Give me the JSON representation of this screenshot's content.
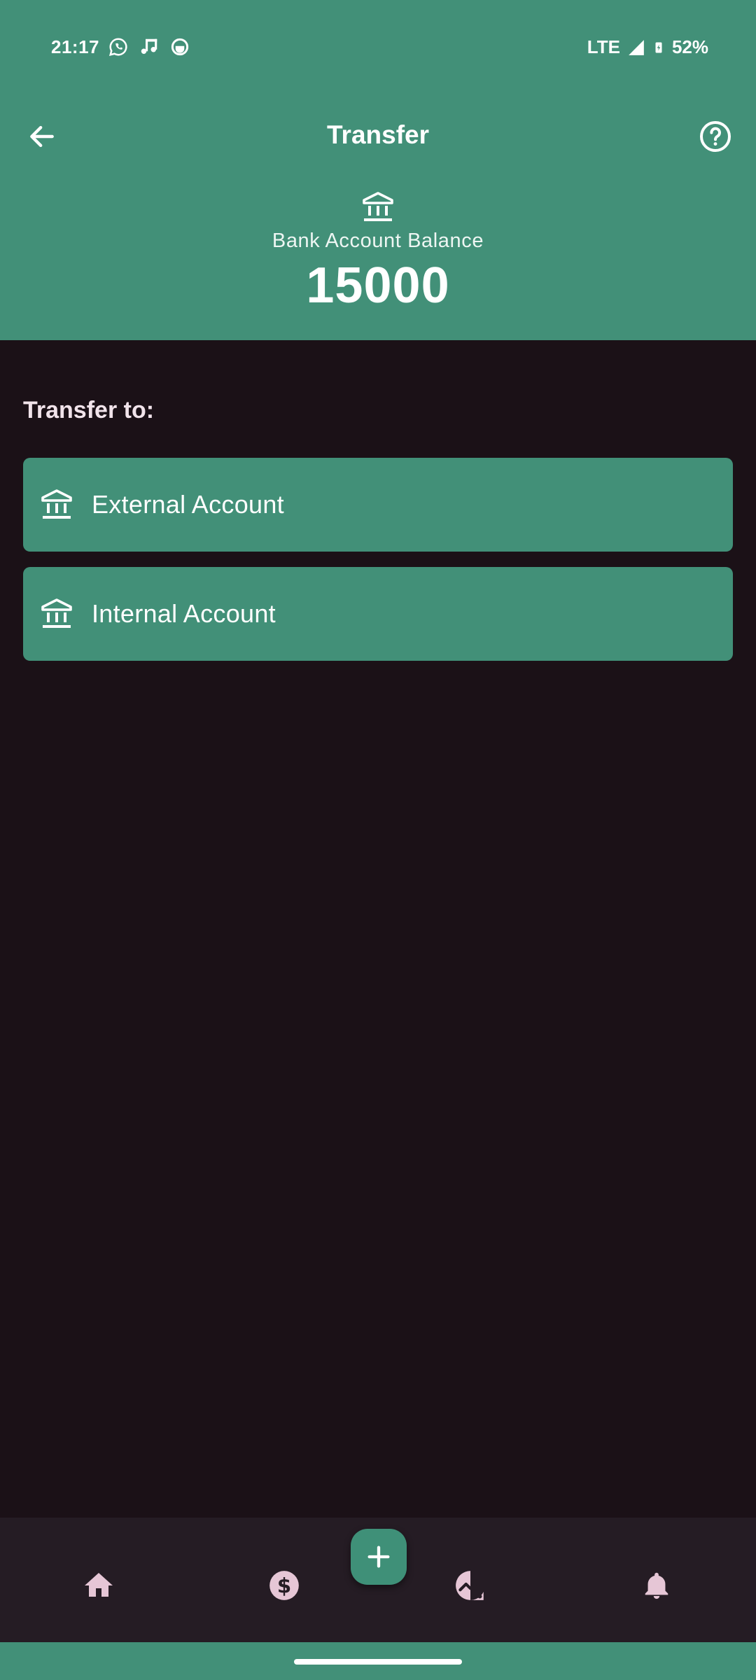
{
  "status_bar": {
    "time": "21:17",
    "network": "LTE",
    "battery": "52%",
    "left_icons": [
      "whatsapp-icon",
      "music-icon",
      "app-icon"
    ],
    "right_icons": [
      "signal-icon",
      "battery-icon"
    ]
  },
  "app_bar": {
    "title": "Transfer",
    "back_icon": "arrow-back-icon",
    "help_icon": "help-circle-icon"
  },
  "balance": {
    "icon": "bank-icon",
    "label": "Bank Account Balance",
    "value": "15000"
  },
  "transfer": {
    "heading": "Transfer to:",
    "options": [
      {
        "label": "External Account",
        "icon": "bank-icon"
      },
      {
        "label": "Internal Account",
        "icon": "bank-icon"
      }
    ]
  },
  "bottom_nav": {
    "items": [
      "home-icon",
      "budget-dollar-icon",
      "stats-trend-icon",
      "notifications-bell-icon"
    ],
    "fab_icon": "add-plus-icon"
  },
  "colors": {
    "header": "#429078",
    "background": "#1b1117",
    "nav_background": "#251c24",
    "nav_icon": "#e6c6d6"
  }
}
